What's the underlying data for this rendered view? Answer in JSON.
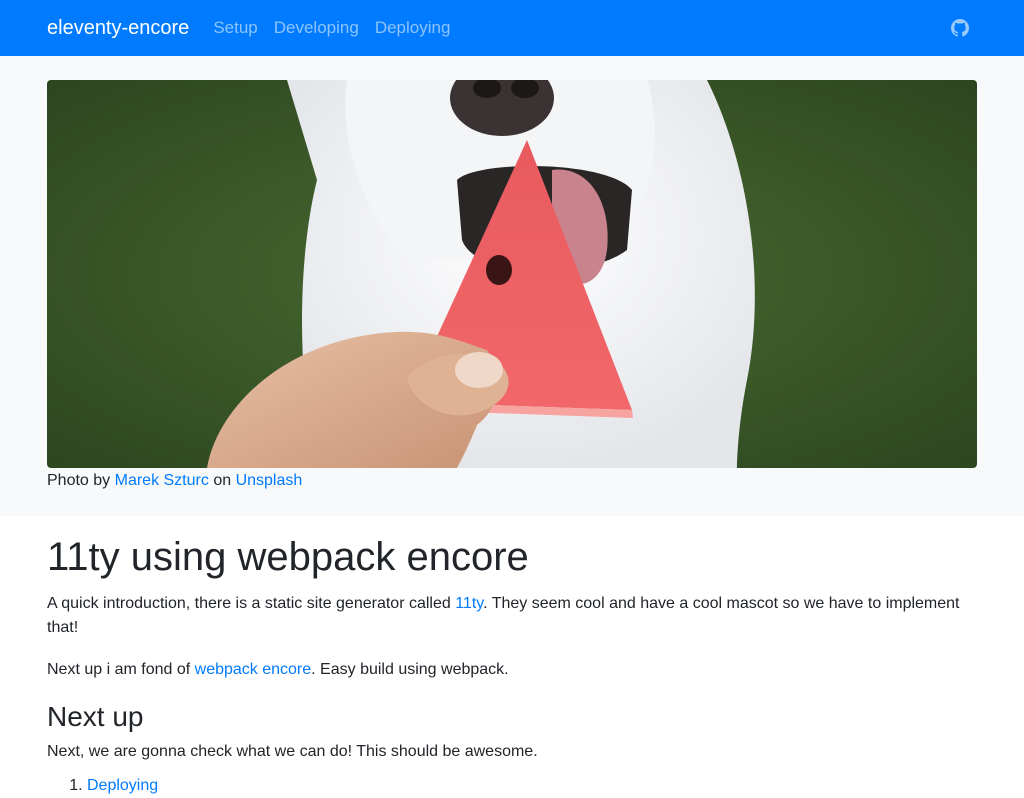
{
  "navbar": {
    "brand": "eleventy-encore",
    "links": [
      "Setup",
      "Developing",
      "Deploying"
    ],
    "github_icon": "github-icon"
  },
  "hero": {
    "caption_prefix": "Photo by",
    "author": "Marek Szturc",
    "on": "on",
    "site": "Unsplash"
  },
  "main": {
    "title": "11ty using webpack encore",
    "intro_before": "A quick introduction, there is a static site generator called ",
    "intro_link": "11ty",
    "intro_after": ". They seem cool and have a cool mascot so we have to implement that!",
    "next_before": "Next up i am fond of ",
    "next_link": "webpack encore",
    "next_after": ". Easy build using webpack.",
    "subtitle": "Next up",
    "next_paragraph": "Next, we are gonna check what we can do! This should be awesome.",
    "list": [
      "Deploying"
    ]
  },
  "colors": {
    "primary": "#007bff",
    "hero_bg": "#f8f9fa",
    "text": "#212529"
  }
}
